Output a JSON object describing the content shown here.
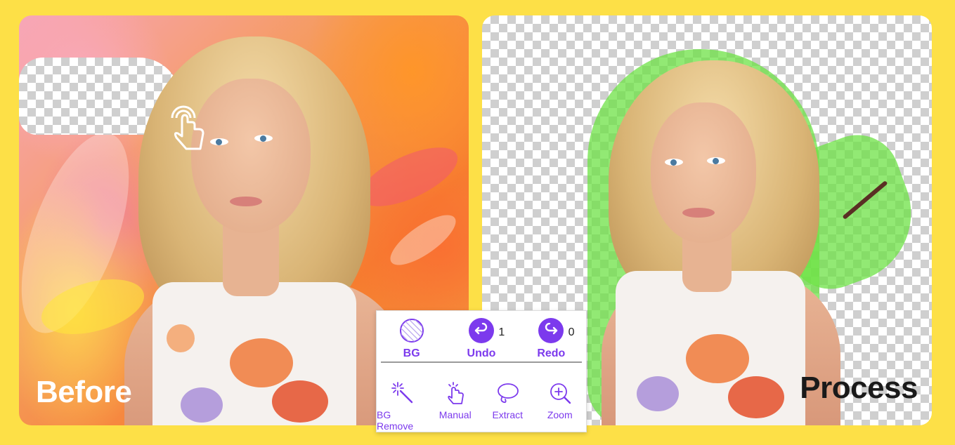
{
  "labels": {
    "before": "Before",
    "process": "Process"
  },
  "toolbar": {
    "top": [
      {
        "id": "bg",
        "label": "BG",
        "icon": "bg-pattern-icon"
      },
      {
        "id": "undo",
        "label": "Undo",
        "count": "1",
        "icon": "undo-icon"
      },
      {
        "id": "redo",
        "label": "Redo",
        "count": "0",
        "icon": "redo-icon"
      }
    ],
    "bottom": [
      {
        "id": "bg-remove",
        "label": "BG Remove",
        "icon": "magic-wand-icon"
      },
      {
        "id": "manual",
        "label": "Manual",
        "icon": "pointer-hand-icon"
      },
      {
        "id": "extract",
        "label": "Extract",
        "icon": "lasso-icon"
      },
      {
        "id": "zoom",
        "label": "Zoom",
        "icon": "zoom-in-icon"
      }
    ]
  },
  "colors": {
    "background": "#fde047",
    "accent": "#7c3aed",
    "highlight": "#6ee146"
  }
}
